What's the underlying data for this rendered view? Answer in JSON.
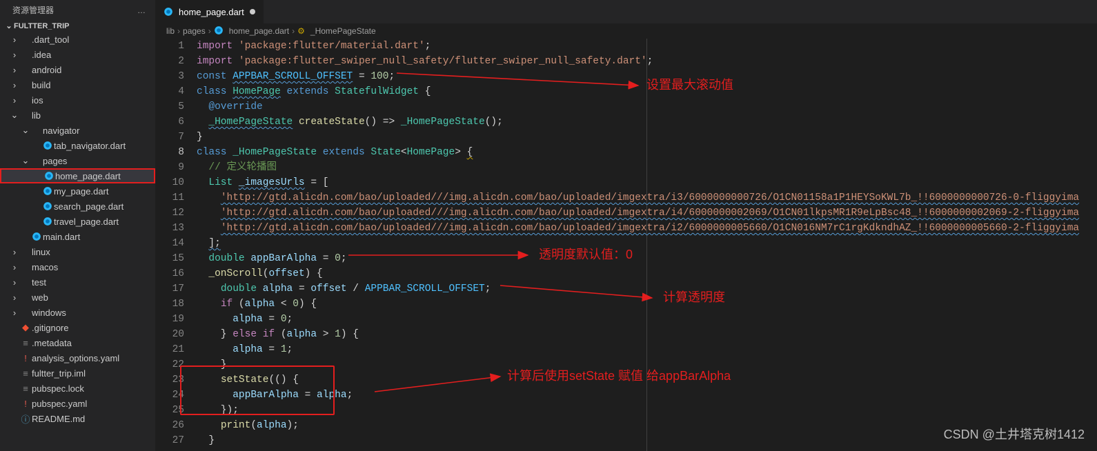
{
  "explorer": {
    "title": "资源管理器",
    "project": "FULTTER_TRIP",
    "tree": [
      {
        "label": ".dart_tool",
        "type": "folder",
        "state": "collapsed",
        "indent": 1
      },
      {
        "label": ".idea",
        "type": "folder",
        "state": "collapsed",
        "indent": 1
      },
      {
        "label": "android",
        "type": "folder",
        "state": "collapsed",
        "indent": 1
      },
      {
        "label": "build",
        "type": "folder",
        "state": "collapsed",
        "indent": 1
      },
      {
        "label": "ios",
        "type": "folder",
        "state": "collapsed",
        "indent": 1
      },
      {
        "label": "lib",
        "type": "folder",
        "state": "expanded",
        "indent": 1
      },
      {
        "label": "navigator",
        "type": "folder",
        "state": "expanded",
        "indent": 2
      },
      {
        "label": "tab_navigator.dart",
        "type": "dart",
        "state": "file",
        "indent": 3
      },
      {
        "label": "pages",
        "type": "folder",
        "state": "expanded",
        "indent": 2
      },
      {
        "label": "home_page.dart",
        "type": "dart",
        "state": "file",
        "indent": 3,
        "selected": true,
        "boxed": true
      },
      {
        "label": "my_page.dart",
        "type": "dart",
        "state": "file",
        "indent": 3
      },
      {
        "label": "search_page.dart",
        "type": "dart",
        "state": "file",
        "indent": 3
      },
      {
        "label": "travel_page.dart",
        "type": "dart",
        "state": "file",
        "indent": 3
      },
      {
        "label": "main.dart",
        "type": "dart",
        "state": "file",
        "indent": 2
      },
      {
        "label": "linux",
        "type": "folder",
        "state": "collapsed",
        "indent": 1
      },
      {
        "label": "macos",
        "type": "folder",
        "state": "collapsed",
        "indent": 1
      },
      {
        "label": "test",
        "type": "folder",
        "state": "collapsed",
        "indent": 1
      },
      {
        "label": "web",
        "type": "folder",
        "state": "collapsed",
        "indent": 1
      },
      {
        "label": "windows",
        "type": "folder",
        "state": "collapsed",
        "indent": 1
      },
      {
        "label": ".gitignore",
        "type": "git",
        "state": "file",
        "indent": 1
      },
      {
        "label": ".metadata",
        "type": "meta",
        "state": "file",
        "indent": 1
      },
      {
        "label": "analysis_options.yaml",
        "type": "yaml",
        "state": "file",
        "indent": 1
      },
      {
        "label": "fultter_trip.iml",
        "type": "meta",
        "state": "file",
        "indent": 1
      },
      {
        "label": "pubspec.lock",
        "type": "meta",
        "state": "file",
        "indent": 1
      },
      {
        "label": "pubspec.yaml",
        "type": "yaml",
        "state": "file",
        "indent": 1
      },
      {
        "label": "README.md",
        "type": "md",
        "state": "file",
        "indent": 1
      }
    ]
  },
  "tab": {
    "label": "home_page.dart",
    "modified": true
  },
  "breadcrumbs": [
    "lib",
    "pages",
    "home_page.dart",
    "_HomePageState"
  ],
  "editor": {
    "current_line": 8,
    "lines": [
      {
        "n": 1,
        "html": "<span class='tok-kw2'>import</span> <span class='tok-str'>'package:flutter/material.dart'</span>;"
      },
      {
        "n": 2,
        "html": "<span class='tok-kw2'>import</span> <span class='tok-str'>'package:flutter_swiper_null_safety/flutter_swiper_null_safety.dart'</span>;"
      },
      {
        "n": 3,
        "html": "<span class='tok-kw'>const</span> <span class='tok-const squiggle'>APPBAR_SCROLL_OFFSET</span> = <span class='tok-num'>100</span>;"
      },
      {
        "n": 4,
        "html": "<span class='tok-kw'>class</span> <span class='tok-cls squiggle'>HomePage</span> <span class='tok-kw'>extends</span> <span class='tok-cls'>StatefulWidget</span> {"
      },
      {
        "n": 5,
        "html": "  <span class='tok-kw'>@override</span>"
      },
      {
        "n": 6,
        "html": "  <span class='tok-cls squiggle'>_HomePageState</span> <span class='tok-fn'>createState</span>() =&gt; <span class='tok-cls'>_HomePageState</span>();"
      },
      {
        "n": 7,
        "html": "<span class='tok-pun'>}</span>"
      },
      {
        "n": 8,
        "html": "<span class='tok-kw'>class</span> <span class='tok-cls'>_HomePageState</span> <span class='tok-kw'>extends</span> <span class='tok-cls'>State</span>&lt;<span class='tok-cls'>HomePage</span>&gt; <span class='squiggle-y'>{</span>"
      },
      {
        "n": 9,
        "html": "  <span class='tok-cmt'>// 定义轮播图</span>"
      },
      {
        "n": 10,
        "html": "  <span class='tok-cls'>List</span> <span class='tok-var squiggle'>_imagesUrls</span> = ["
      },
      {
        "n": 11,
        "html": "    <span class='tok-str squiggle'>'http://gtd.alicdn.com/bao/uploaded///img.alicdn.com/bao/uploaded/imgextra/i3/6000000000726/O1CN01158a1P1HEYSoKWL7b_!!6000000000726-0-fliggyima</span>"
      },
      {
        "n": 12,
        "html": "    <span class='tok-str squiggle'>'http://gtd.alicdn.com/bao/uploaded///img.alicdn.com/bao/uploaded/imgextra/i4/6000000002069/O1CN01lkpsMR1R9eLpBsc48_!!6000000002069-2-fliggyima</span>"
      },
      {
        "n": 13,
        "html": "    <span class='tok-str squiggle'>'http://gtd.alicdn.com/bao/uploaded///img.alicdn.com/bao/uploaded/imgextra/i2/6000000005660/O1CN016NM7rC1rgKdkndhAZ_!!6000000005660-2-fliggyima</span>"
      },
      {
        "n": 14,
        "html": "  <span class='squiggle'>];</span>"
      },
      {
        "n": 15,
        "html": "  <span class='tok-cls'>double</span> <span class='tok-var'>appBarAlpha</span> = <span class='tok-num'>0</span>;"
      },
      {
        "n": 16,
        "html": "  <span class='tok-fn'>_onScroll</span>(<span class='tok-var'>offset</span>) {"
      },
      {
        "n": 17,
        "html": "    <span class='tok-cls'>double</span> <span class='tok-var'>alpha</span> = <span class='tok-var'>offset</span> / <span class='tok-const'>APPBAR_SCROLL_OFFSET</span>;"
      },
      {
        "n": 18,
        "html": "    <span class='tok-kw2'>if</span> (<span class='tok-var'>alpha</span> &lt; <span class='tok-num'>0</span>) {"
      },
      {
        "n": 19,
        "html": "      <span class='tok-var'>alpha</span> = <span class='tok-num'>0</span>;"
      },
      {
        "n": 20,
        "html": "    } <span class='tok-kw2'>else</span> <span class='tok-kw2'>if</span> (<span class='tok-var'>alpha</span> &gt; <span class='tok-num'>1</span>) {"
      },
      {
        "n": 21,
        "html": "      <span class='tok-var'>alpha</span> = <span class='tok-num'>1</span>;"
      },
      {
        "n": 22,
        "html": "    }"
      },
      {
        "n": 23,
        "html": "    <span class='tok-fn'>setState</span>(() {"
      },
      {
        "n": 24,
        "html": "      <span class='tok-var'>appBarAlpha</span> = <span class='tok-var'>alpha</span>;"
      },
      {
        "n": 25,
        "html": "    });"
      },
      {
        "n": 26,
        "html": "    <span class='tok-fn'>print</span>(<span class='tok-var'>alpha</span>);"
      },
      {
        "n": 27,
        "html": "  <span class='tok-pun'>}</span>"
      }
    ]
  },
  "annotations": {
    "a1": "设置最大滚动值",
    "a2": "透明度默认值：0",
    "a3": "计算透明度",
    "a4": "计算后使用setState 赋值 给appBarAlpha"
  },
  "watermark": "CSDN @土井塔克树1412"
}
